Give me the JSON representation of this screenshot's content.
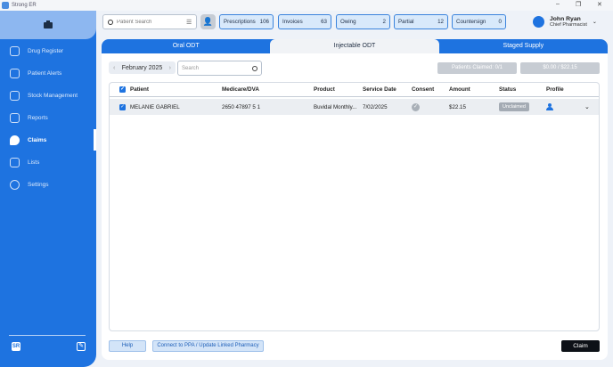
{
  "window": {
    "title": "Strong ER",
    "controls": [
      "–",
      "❐",
      "✕"
    ]
  },
  "sidebar": {
    "items": [
      {
        "label": "Drug Register",
        "icon": "drug-register-icon"
      },
      {
        "label": "Patient Alerts",
        "icon": "bell-icon"
      },
      {
        "label": "Stock Management",
        "icon": "box-icon"
      },
      {
        "label": "Reports",
        "icon": "chart-icon"
      },
      {
        "label": "Claims",
        "icon": "shield-check-icon",
        "active": true
      },
      {
        "label": "Lists",
        "icon": "list-icon"
      },
      {
        "label": "Settings",
        "icon": "gear-icon"
      }
    ],
    "logo_text": "SR",
    "edit_icon": "✎"
  },
  "header": {
    "search_placeholder": "Patient Search",
    "chips": [
      {
        "label": "Prescriptions",
        "count": "106"
      },
      {
        "label": "Invoices",
        "count": "63"
      },
      {
        "label": "Owing",
        "count": "2"
      },
      {
        "label": "Partial",
        "count": "12"
      },
      {
        "label": "Countersign",
        "count": "0"
      }
    ],
    "user": {
      "name": "John Ryan",
      "role": "Chief Pharmacist"
    }
  },
  "claims": {
    "tabs": [
      "Oral ODT",
      "Injectable ODT",
      "Staged Supply"
    ],
    "active_tab": 1,
    "month": "February 2025",
    "search_placeholder": "Search",
    "patients_claimed": "Patients Claimed: 0/1",
    "amount_summary": "$0.00 / $22.15",
    "columns": [
      "Patient",
      "Medicare/DVA",
      "Product",
      "Service Date",
      "Consent",
      "Amount",
      "Status",
      "Profile"
    ],
    "rows": [
      {
        "patient": "MELANIE GABRIEL",
        "medicare": "2650 47897 5 1",
        "product": "Buvidal Monthly...",
        "service_date": "7/02/2025",
        "amount": "$22.15",
        "status": "Unclaimed"
      }
    ],
    "help_label": "Help",
    "connect_label": "Connect to PPA / Update Linked Pharmacy",
    "claim_label": "Claim"
  },
  "colors": {
    "accent": "#1e73e0",
    "sidebar": "#1e73e0",
    "chip_bg": "#d8e9fb"
  }
}
